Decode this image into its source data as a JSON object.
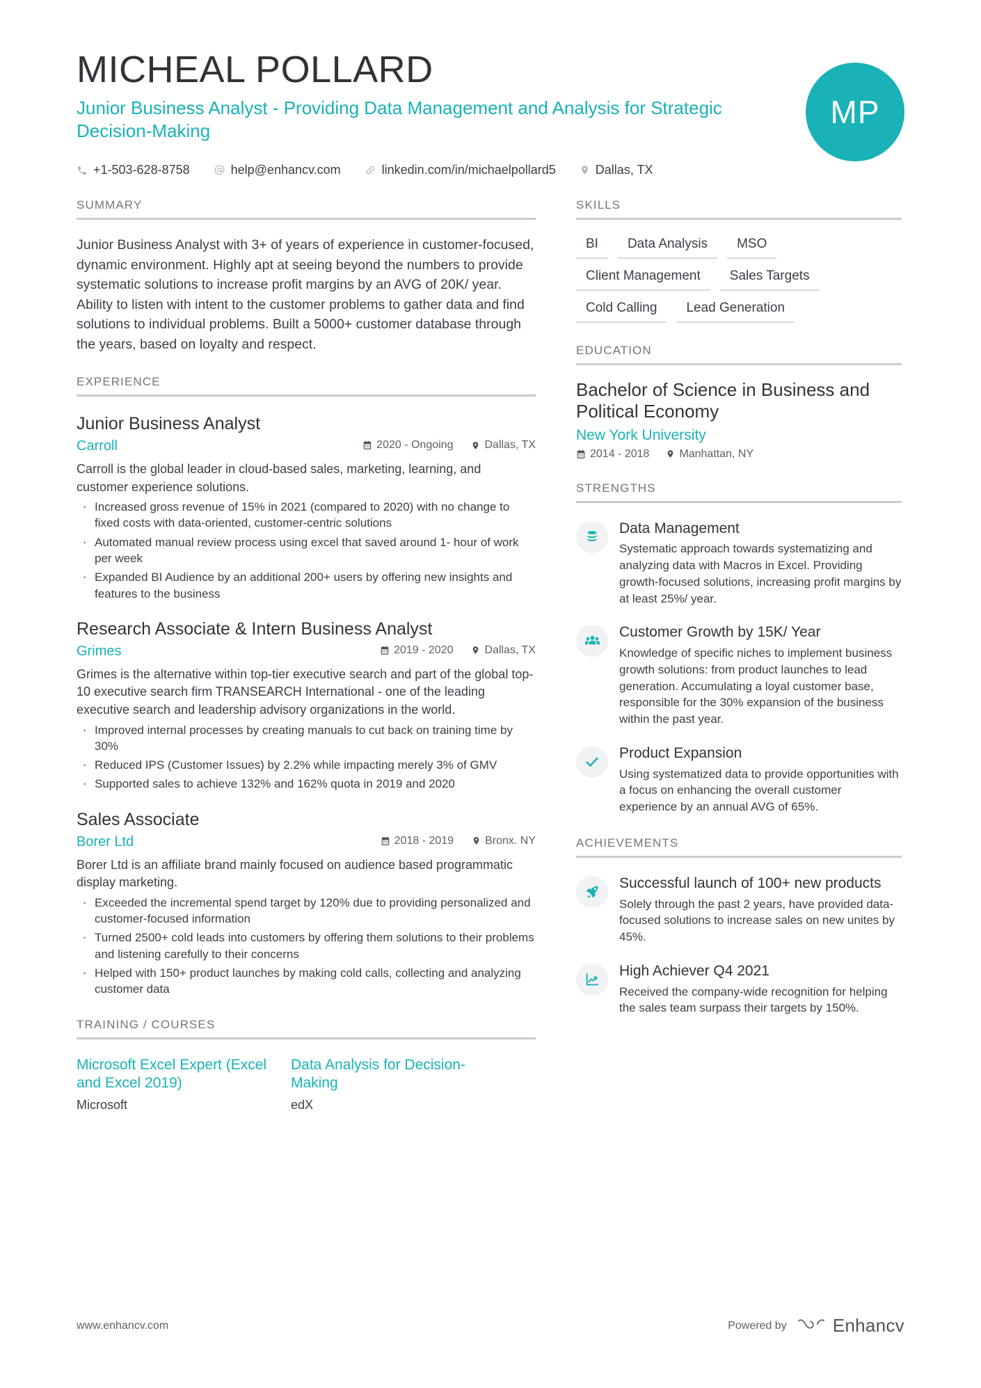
{
  "header": {
    "name": "MICHEAL POLLARD",
    "headline": "Junior Business Analyst - Providing Data Management and Analysis for Strategic Decision-Making",
    "initials": "MP",
    "contact": {
      "phone": "+1-503-628-8758",
      "email": "help@enhancv.com",
      "linkedin": "linkedin.com/in/michaelpollard5",
      "location": "Dallas, TX"
    }
  },
  "summary": {
    "title": "SUMMARY",
    "text": "Junior Business Analyst with 3+ of years of experience in customer-focused, dynamic environment. Highly apt at seeing beyond the numbers to provide systematic solutions to increase profit margins by an AVG of 20K/ year. Ability to listen with intent to the customer problems to gather data and find solutions to individual problems. Built a 5000+ customer database through the years, based on loyalty and respect."
  },
  "experience": {
    "title": "EXPERIENCE",
    "jobs": [
      {
        "role": "Junior Business Analyst",
        "company": "Carroll",
        "dates": "2020 - Ongoing",
        "location": "Dallas, TX",
        "description": "Carroll is the global leader in cloud-based sales, marketing, learning, and customer experience solutions.",
        "bullets": [
          "Increased gross revenue of 15% in 2021 (compared to 2020) with no change to fixed costs with data-oriented, customer-centric solutions",
          "Automated manual review process using excel that saved around 1- hour of work per week",
          "Expanded BI Audience by an additional 200+ users by offering new insights and features to the business"
        ]
      },
      {
        "role": "Research Associate & Intern Business Analyst",
        "company": "Grimes",
        "dates": "2019 - 2020",
        "location": "Dallas, TX",
        "description": "Grimes is the alternative within top-tier executive search and part of the global top-10 executive search firm TRANSEARCH International - one of the leading executive search and leadership advisory organizations in the world.",
        "bullets": [
          "Improved internal processes by creating manuals to cut back on training time by 30%",
          "Reduced IPS (Customer Issues) by 2.2% while impacting merely 3% of GMV",
          "Supported sales to achieve 132% and 162% quota in 2019 and 2020"
        ]
      },
      {
        "role": "Sales Associate",
        "company": "Borer Ltd",
        "dates": "2018 - 2019",
        "location": "Bronx. NY",
        "description": "Borer Ltd is an affiliate brand mainly focused on audience based programmatic display marketing.",
        "bullets": [
          "Exceeded the incremental spend target by 120% due to providing personalized and customer-focused information",
          "Turned 2500+ cold leads into customers by offering them solutions to their problems and listening carefully to their concerns",
          "Helped with 150+ product launches by making cold calls, collecting and analyzing customer data"
        ]
      }
    ]
  },
  "training": {
    "title": "TRAINING / COURSES",
    "courses": [
      {
        "name": "Microsoft Excel Expert (Excel and Excel 2019)",
        "provider": "Microsoft"
      },
      {
        "name": "Data Analysis for Decision-Making",
        "provider": "edX"
      }
    ]
  },
  "skills": {
    "title": "SKILLS",
    "items": [
      "BI",
      "Data Analysis",
      "MSO",
      "Client Management",
      "Sales Targets",
      "Cold Calling",
      "Lead Generation"
    ]
  },
  "education": {
    "title": "EDUCATION",
    "entries": [
      {
        "degree": "Bachelor of Science in Business and Political Economy",
        "school": "New York University",
        "dates": "2014 - 2018",
        "location": "Manhattan, NY"
      }
    ]
  },
  "strengths": {
    "title": "STRENGTHS",
    "items": [
      {
        "icon": "database-icon",
        "title": "Data Management",
        "text": "Systematic approach towards systematizing and analyzing data with Macros in Excel. Providing growth-focused solutions, increasing profit margins by at least 25%/ year."
      },
      {
        "icon": "users-group-icon",
        "title": "Customer Growth by 15K/ Year",
        "text": "Knowledge of specific niches to implement business growth solutions: from product launches to lead generation. Accumulating a loyal customer base, responsible for the 30% expansion of the business within the past year."
      },
      {
        "icon": "check-icon",
        "title": "Product Expansion",
        "text": "Using systematized data to provide opportunities with a focus on enhancing the overall customer experience by an annual AVG of 65%."
      }
    ]
  },
  "achievements": {
    "title": "ACHIEVEMENTS",
    "items": [
      {
        "icon": "rocket-icon",
        "title": "Successful launch of 100+ new products",
        "text": "Solely through the past 2 years, have provided data-focused solutions to increase sales on new unites by 45%."
      },
      {
        "icon": "chart-line-icon",
        "title": "High Achiever Q4 2021",
        "text": "Received the company-wide recognition for helping the sales team surpass their targets by 150%."
      }
    ]
  },
  "footer": {
    "website": "www.enhancv.com",
    "powered_by": "Powered by",
    "brand": "Enhancv"
  },
  "colors": {
    "accent": "#18b2b7",
    "heading": "#2f3439",
    "body": "#3a4047",
    "muted": "#6f767d",
    "rule": "#c8cccf"
  }
}
